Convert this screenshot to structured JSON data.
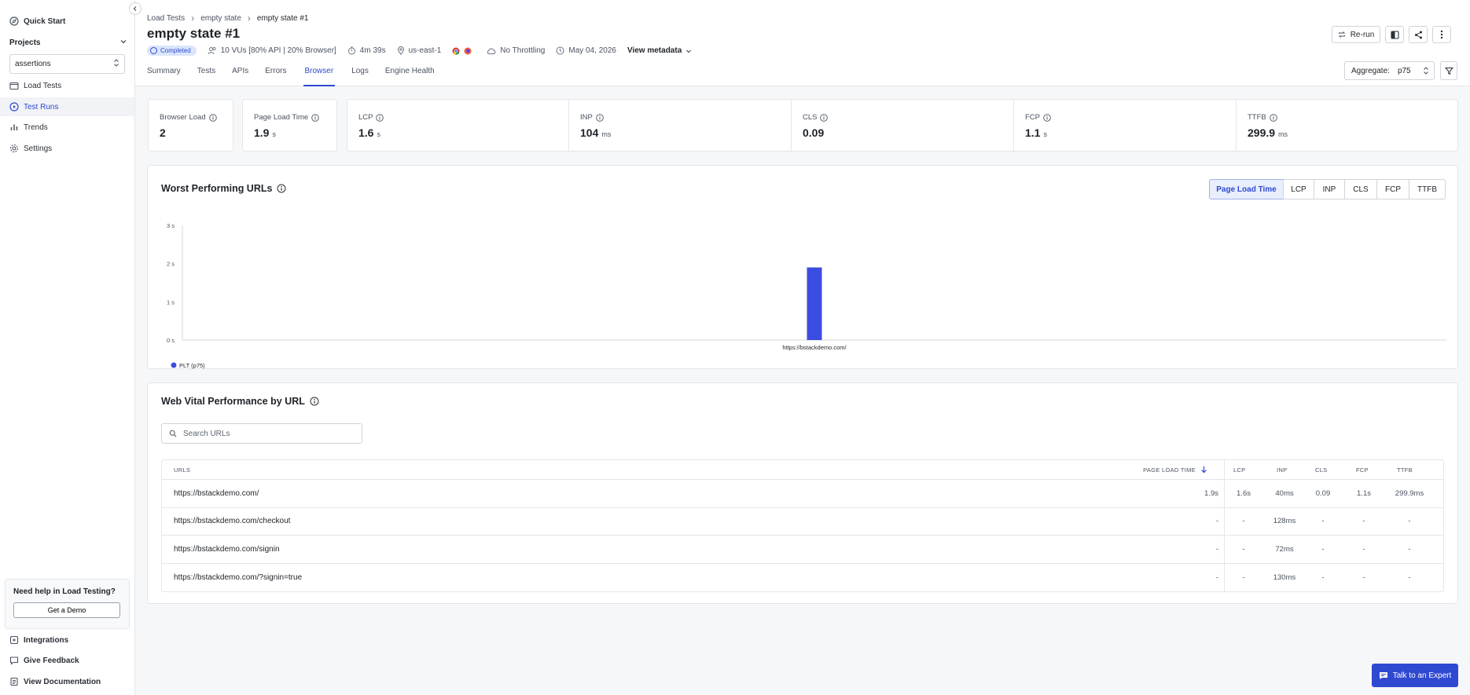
{
  "sidebar": {
    "quick_start": "Quick Start",
    "projects_label": "Projects",
    "project_selected": "assertions",
    "items": [
      {
        "label": "Load Tests"
      },
      {
        "label": "Test Runs"
      },
      {
        "label": "Trends"
      },
      {
        "label": "Settings"
      }
    ],
    "help": {
      "title": "Need help in Load Testing?",
      "button": "Get a Demo"
    },
    "footer": [
      {
        "label": "Integrations"
      },
      {
        "label": "Give Feedback"
      },
      {
        "label": "View Documentation"
      }
    ]
  },
  "breadcrumb": [
    "Load Tests",
    "empty state",
    "empty state #1"
  ],
  "page_title": "empty state #1",
  "meta": {
    "status": "Completed",
    "vus": "10 VUs [80% API | 20% Browser]",
    "duration": "4m 39s",
    "region": "us-east-1",
    "throttling": "No Throttling",
    "date": "May 04, 2026",
    "view_metadata": "View metadata"
  },
  "tabs": [
    "Summary",
    "Tests",
    "APIs",
    "Errors",
    "Browser",
    "Logs",
    "Engine Health"
  ],
  "active_tab": "Browser",
  "actions": {
    "rerun": "Re-run"
  },
  "aggregate": {
    "label": "Aggregate:",
    "value": "p75"
  },
  "metrics": [
    {
      "label": "Browser Load",
      "value": "2",
      "unit": ""
    },
    {
      "label": "Page Load Time",
      "value": "1.9",
      "unit": "s"
    },
    {
      "label": "LCP",
      "value": "1.6",
      "unit": "s"
    },
    {
      "label": "INP",
      "value": "104",
      "unit": "ms"
    },
    {
      "label": "CLS",
      "value": "0.09",
      "unit": ""
    },
    {
      "label": "FCP",
      "value": "1.1",
      "unit": "s"
    },
    {
      "label": "TTFB",
      "value": "299.9",
      "unit": "ms"
    }
  ],
  "worst_urls": {
    "title": "Worst Performing URLs",
    "segments": [
      "Page Load Time",
      "LCP",
      "INP",
      "CLS",
      "FCP",
      "TTFB"
    ],
    "active_segment": "Page Load Time"
  },
  "chart_data": {
    "type": "bar",
    "categories": [
      "https://bstackdemo.com/"
    ],
    "series": [
      {
        "name": "PLT (p75)",
        "values": [
          1.9
        ],
        "color": "#3b4de0"
      }
    ],
    "ylim": [
      0,
      3
    ],
    "yticks": [
      "0 s",
      "1 s",
      "2 s",
      "3 s"
    ],
    "legend": "bottom-left"
  },
  "web_vitals": {
    "title": "Web Vital Performance by URL",
    "search_placeholder": "Search URLs",
    "columns": [
      "URLS",
      "PAGE LOAD TIME",
      "LCP",
      "INP",
      "CLS",
      "FCP",
      "TTFB"
    ],
    "rows": [
      {
        "url": "https://bstackdemo.com/",
        "plt": "1.9s",
        "lcp": "1.6s",
        "inp": "40ms",
        "cls": "0.09",
        "fcp": "1.1s",
        "ttfb": "299.9ms"
      },
      {
        "url": "https://bstackdemo.com/checkout",
        "plt": "-",
        "lcp": "-",
        "inp": "128ms",
        "cls": "-",
        "fcp": "-",
        "ttfb": "-"
      },
      {
        "url": "https://bstackdemo.com/signin",
        "plt": "-",
        "lcp": "-",
        "inp": "72ms",
        "cls": "-",
        "fcp": "-",
        "ttfb": "-"
      },
      {
        "url": "https://bstackdemo.com/?signin=true",
        "plt": "-",
        "lcp": "-",
        "inp": "130ms",
        "cls": "-",
        "fcp": "-",
        "ttfb": "-"
      }
    ]
  },
  "talk_to_expert": "Talk to an Expert"
}
